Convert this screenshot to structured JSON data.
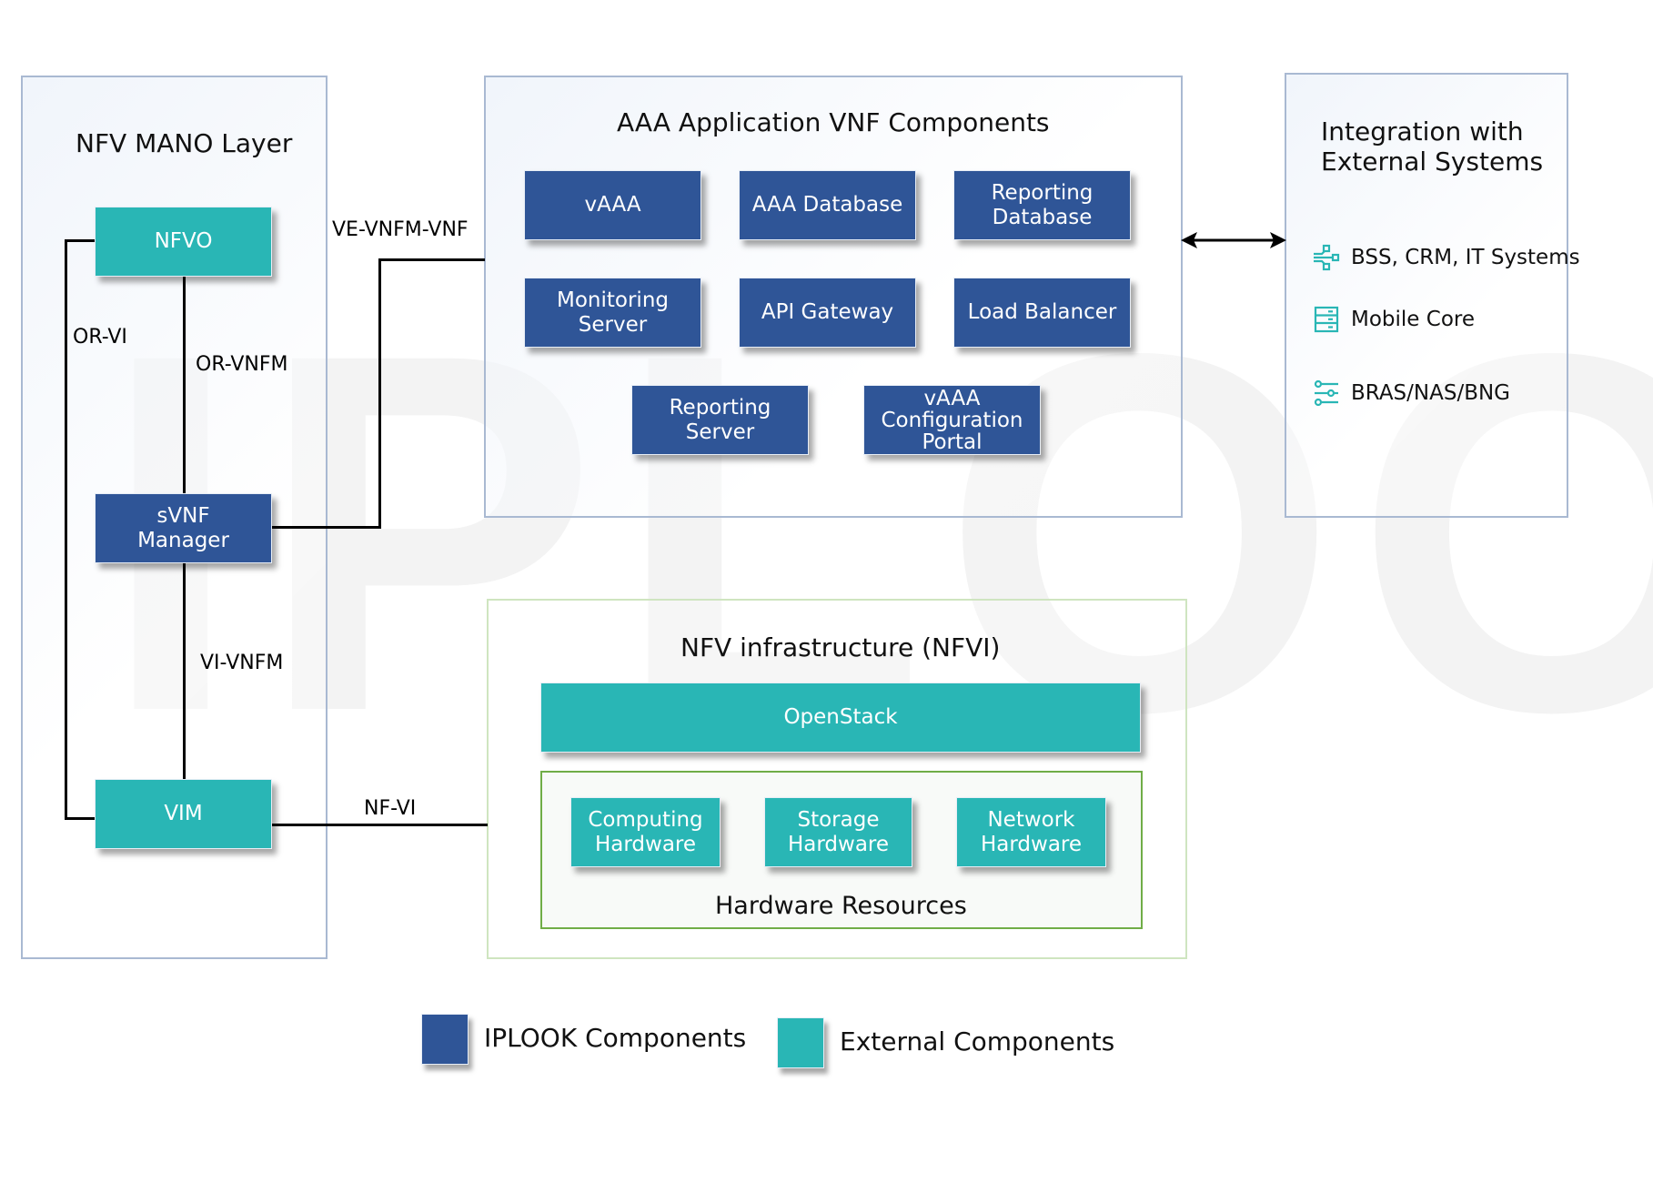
{
  "watermark": "IPLOOK",
  "colors": {
    "iplook_component": "#2f5597",
    "external_component": "#29b6b5",
    "panel_border": "#a9b9d2",
    "nfvi_border": "#cfe5c0",
    "hardware_border": "#70ad47",
    "watermark": "#f3f3f3"
  },
  "mano": {
    "title": "NFV MANO Layer",
    "nfvo": "NFVO",
    "svnf_manager": "sVNF\nManager",
    "vim": "VIM",
    "interfaces": {
      "or_vi": "OR-VI",
      "or_vnfm": "OR-VNFM",
      "vi_vnfm": "VI-VNFM"
    }
  },
  "links": {
    "ve_vnfm_vnf": "VE-VNFM-VNF",
    "nf_vi": "NF-VI"
  },
  "aaa": {
    "title": "AAA Application VNF Components",
    "components": [
      "vAAA",
      "AAA Database",
      "Reporting\nDatabase",
      "Monitoring\nServer",
      "API Gateway",
      "Load Balancer",
      "Reporting\nServer",
      "vAAA\nConfiguration\nPortal"
    ]
  },
  "integration": {
    "title_line1": "Integration with",
    "title_line2": "External Systems",
    "items": [
      {
        "icon": "network-flow-icon",
        "label": "BSS, CRM, IT Systems"
      },
      {
        "icon": "server-rack-icon",
        "label": "Mobile Core"
      },
      {
        "icon": "sliders-icon",
        "label": "BRAS/NAS/BNG"
      }
    ]
  },
  "nfvi": {
    "title": "NFV infrastructure (NFVI)",
    "openstack": "OpenStack",
    "hardware_title": "Hardware Resources",
    "hardware": [
      "Computing\nHardware",
      "Storage\nHardware",
      "Network\nHardware"
    ]
  },
  "legend": {
    "iplook": "IPLOOK Components",
    "external": "External Components"
  }
}
